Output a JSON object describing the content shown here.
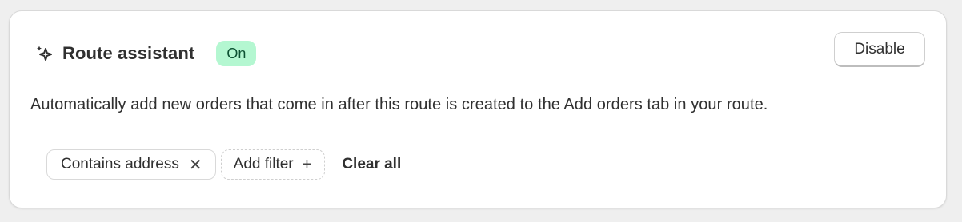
{
  "card": {
    "icon": "sparkle-icon",
    "title": "Route assistant",
    "status_badge": "On",
    "disable_label": "Disable",
    "description": "Automatically add new orders that come in after this route is created to the Add orders tab in your route."
  },
  "filters": {
    "active_filter_label": "Contains address",
    "remove_icon": "close-icon",
    "add_filter_label": "Add filter",
    "add_icon": "plus-icon",
    "clear_all_label": "Clear all"
  },
  "colors": {
    "badge_background": "#b4f7d1",
    "badge_text": "#0c5132",
    "page_background": "#efefef",
    "card_background": "#ffffff"
  }
}
